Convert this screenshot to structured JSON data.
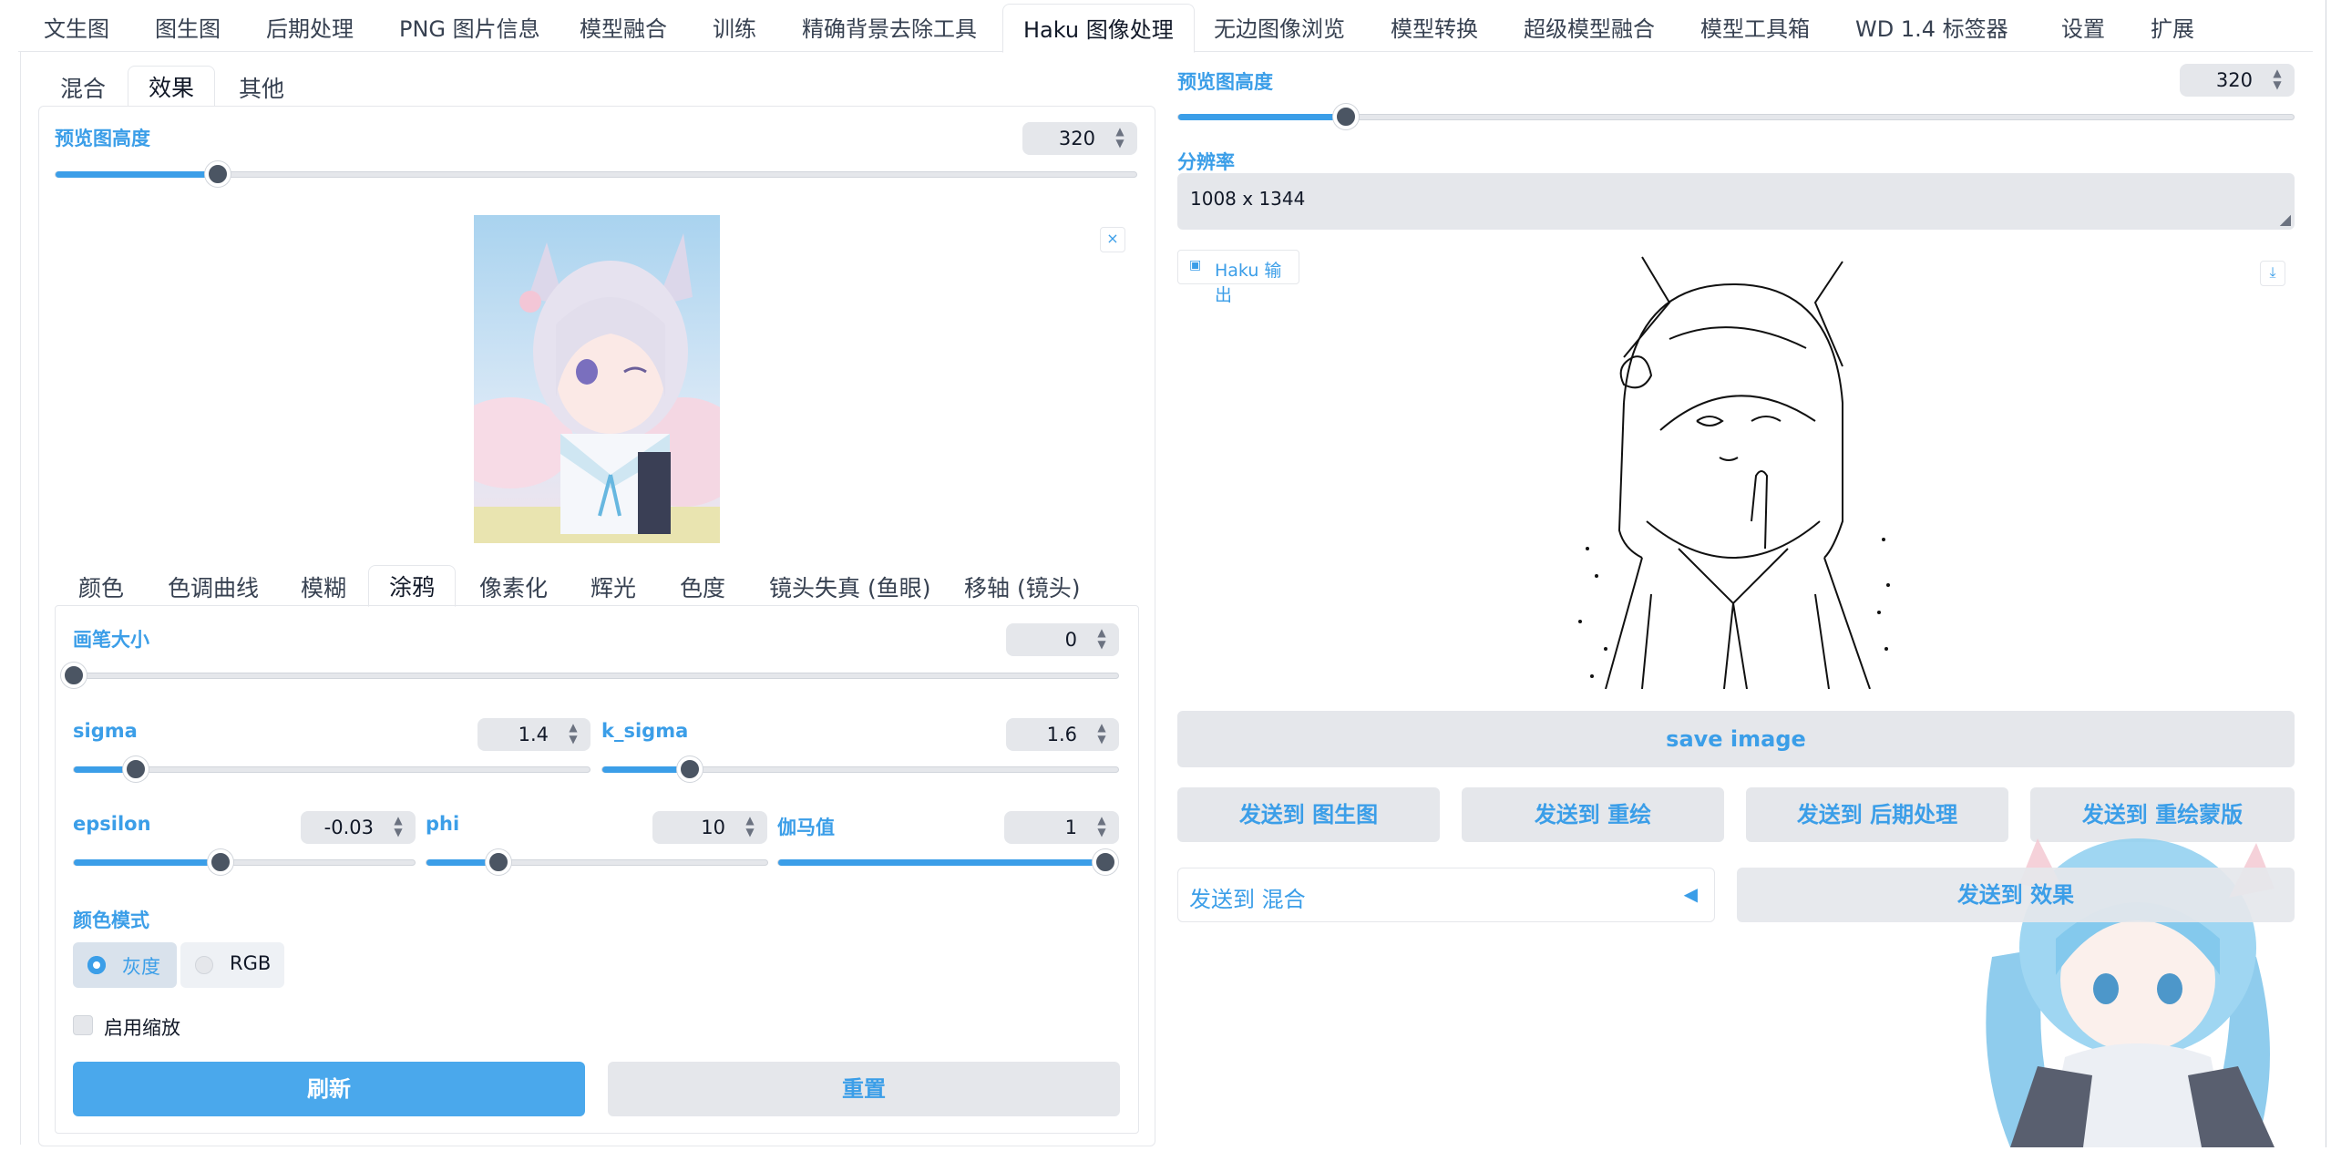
{
  "top_tabs": [
    "文生图",
    "图生图",
    "后期处理",
    "PNG 图片信息",
    "模型融合",
    "训练",
    "精确背景去除工具",
    "Haku 图像处理",
    "无边图像浏览",
    "模型转换",
    "超级模型融合",
    "模型工具箱",
    "WD 1.4 标签器",
    "设置",
    "扩展"
  ],
  "sub_tabs": [
    "混合",
    "效果",
    "其他"
  ],
  "effect_tabs": [
    "颜色",
    "色调曲线",
    "模糊",
    "涂鸦",
    "像素化",
    "辉光",
    "色度",
    "镜头失真 (鱼眼)",
    "移轴 (镜头)"
  ],
  "left": {
    "preview_height_label": "预览图高度",
    "preview_height_value": "320",
    "preview_height_level": 0.15,
    "close_glyph": "×"
  },
  "sketch": {
    "brush_label": "画笔大小",
    "brush_value": "0",
    "brush_level": 0.0,
    "sigma_label": "sigma",
    "sigma_value": "1.4",
    "sigma_level": 0.12,
    "k_sigma_label": "k_sigma",
    "k_sigma_value": "1.6",
    "k_sigma_level": 0.17,
    "epsilon_label": "epsilon",
    "epsilon_value": "-0.03",
    "epsilon_level": 0.43,
    "phi_label": "phi",
    "phi_value": "10",
    "phi_level": 0.21,
    "gamma_label": "伽马值",
    "gamma_value": "1",
    "gamma_level": 1.0,
    "color_mode_label": "颜色模式",
    "color_mode_options": [
      "灰度",
      "RGB"
    ],
    "color_mode_selected": "灰度",
    "scale_checkbox_label": "启用缩放",
    "refresh_label": "刷新",
    "reset_label": "重置"
  },
  "right": {
    "preview_height_label": "预览图高度",
    "preview_height_value": "320",
    "preview_height_level": 0.15,
    "resolution_label": "分辨率",
    "resolution_value": "1008 x 1344",
    "output_label": "Haku 输出",
    "save_label": "save image",
    "send_img2img": "发送到 图生图",
    "send_inpaint": "发送到 重绘",
    "send_extras": "发送到 后期处理",
    "send_inpaint_mask": "发送到 重绘蒙版",
    "send_blend": "发送到 混合",
    "send_effect": "发送到 效果"
  },
  "colors": {
    "accent": "#3b9ee8",
    "button_blue": "#4aa8ec",
    "gray_bg": "#e5e7eb"
  }
}
